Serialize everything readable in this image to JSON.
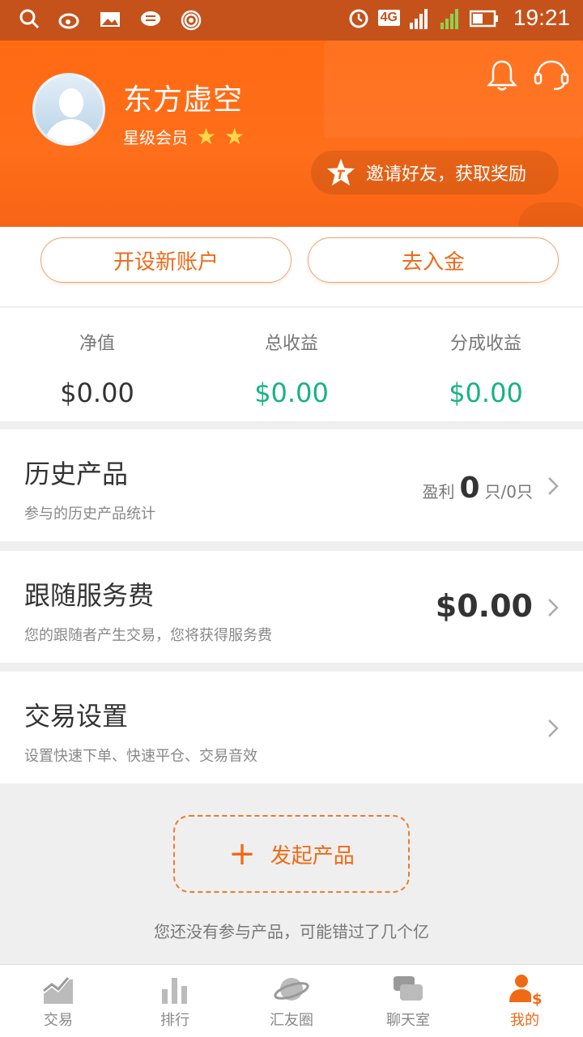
{
  "status_bar": {
    "time": "19:21",
    "network": "4G",
    "sim1": "1",
    "sim2": "2"
  },
  "header": {
    "user_name": "东方虚空",
    "member_label": "星级会员",
    "stars": [
      "★",
      "★"
    ],
    "invite_text": "邀请好友，获取奖励"
  },
  "actions": {
    "open_account": "开设新账户",
    "deposit": "去入金"
  },
  "stats": [
    {
      "label": "净值",
      "value": "$0.00"
    },
    {
      "label": "总收益",
      "value": "$0.00"
    },
    {
      "label": "分成收益",
      "value": "$0.00"
    }
  ],
  "rows": {
    "history": {
      "title": "历史产品",
      "subtitle": "参与的历史产品统计",
      "profit_label": "盈利",
      "profit_count": "0",
      "profit_suffix": "只/0只"
    },
    "fee": {
      "title": "跟随服务费",
      "subtitle": "您的跟随者产生交易，您将获得服务费",
      "value": "$0.00"
    },
    "settings": {
      "title": "交易设置",
      "subtitle": "设置快速下单、快速平仓、交易音效"
    }
  },
  "launch": {
    "icon": "+",
    "label": "发起产品",
    "hint": "您还没有参与产品，可能错过了几个亿"
  },
  "tabs": [
    {
      "label": "交易"
    },
    {
      "label": "排行"
    },
    {
      "label": "汇友圈"
    },
    {
      "label": "聊天室"
    },
    {
      "label": "我的"
    }
  ],
  "colors": {
    "accent": "#ff6a12",
    "green": "#16b381",
    "statusbar": "#c5521b"
  }
}
